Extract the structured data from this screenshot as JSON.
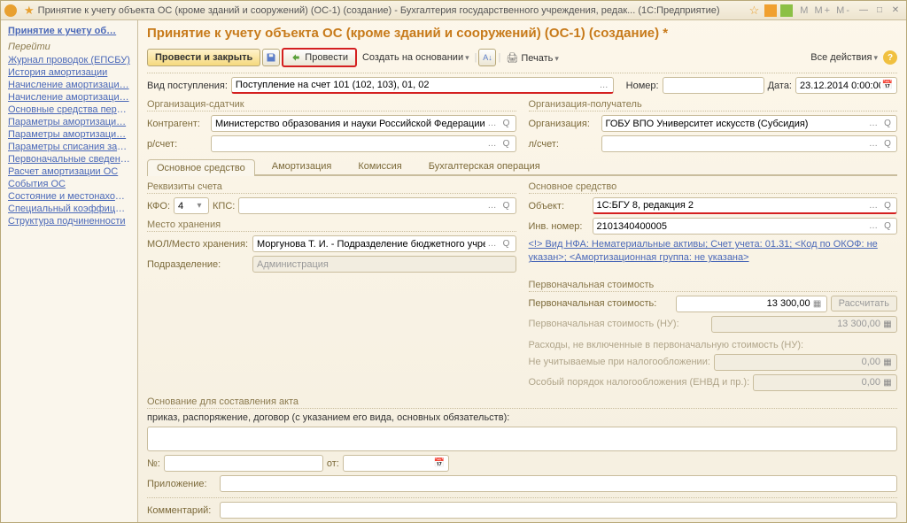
{
  "title": "Принятие к учету объекта ОС (кроме зданий и сооружений) (ОС-1) (создание) - Бухгалтерия государственного учреждения, редак... (1С:Предприятие)",
  "sidebar": {
    "heading": "Принятие к учету об…",
    "goto": "Перейти",
    "links": [
      "Журнал проводок (ЕПСБУ)",
      "История амортизации",
      "Начисление амортизаци…",
      "Начисление амортизаци…",
      "Основные средства пере…",
      "Параметры амортизаци…",
      "Параметры амортизаци…",
      "Параметры списания зат…",
      "Первоначальные сведени…",
      "Расчет амортизации ОС",
      "События ОС",
      "Состояние и местонахожд…",
      "Специальный коэффицие…",
      "Структура подчиненности"
    ]
  },
  "page_title": "Принятие к учету объекта ОС (кроме зданий и сооружений) (ОС-1) (создание) *",
  "toolbar": {
    "post_close": "Провести и закрыть",
    "post": "Провести",
    "create_based": "Создать на основании",
    "print": "Печать",
    "all_actions": "Все действия"
  },
  "labels": {
    "receipt_type": "Вид поступления:",
    "number": "Номер:",
    "date": "Дата:",
    "sender_group": "Организация-сдатчик",
    "receiver_group": "Организация-получатель",
    "counterparty": "Контрагент:",
    "org": "Организация:",
    "r_account": "р/счет:",
    "l_account": "л/счет:",
    "account_req": "Реквизиты счета",
    "main_asset": "Основное средство",
    "kfo": "КФО:",
    "kps": "КПС:",
    "object": "Объект:",
    "storage": "Место хранения",
    "inv_no": "Инв. номер:",
    "mol": "МОЛ/Место хранения:",
    "dept": "Подразделение:",
    "initial_cost_group": "Первоначальная стоимость",
    "initial_cost": "Первоначальная стоимость:",
    "initial_cost_nu": "Первоначальная стоимость (НУ):",
    "expenses_not_incl": "Расходы, не включенные в первоначальную стоимость (НУ):",
    "not_taxable": "Не учитываемые при налогообложении:",
    "special_tax": "Особый порядок налогообложения (ЕНВД и пр.):",
    "basis_group": "Основание для составления акта",
    "basis_desc": "приказ, распоряжение, договор (с указанием его вида, основных обязательств):",
    "no": "№:",
    "from": "от:",
    "attachment": "Приложение:",
    "comment": "Комментарий:",
    "calc": "Рассчитать"
  },
  "values": {
    "receipt_type": "Поступление на счет 101 (102, 103), 01, 02",
    "date": "23.12.2014 0:00:00",
    "counterparty": "Министерство образования и науки Российской Федерации",
    "org": "ГОБУ ВПО Университет искусств (Субсидия)",
    "kfo": "4",
    "object": "1С:БГУ 8, редакция 2",
    "inv_no": "2101340400005",
    "mol": "Моргунова Т. И. - Подразделение бюджетного учреждени",
    "dept": "Администрация",
    "nfa_link": "<!> Вид НФА: Нематериальные активы; Счет учета: 01.31; <Код по ОКОФ: не указан>; <Амортизационная группа: не указана>",
    "initial_cost": "13 300,00",
    "initial_cost_nu": "13 300,00",
    "not_taxable": "0,00",
    "special_tax": "0,00"
  },
  "tabs": [
    "Основное средство",
    "Амортизация",
    "Комиссия",
    "Бухгалтерская операция"
  ]
}
